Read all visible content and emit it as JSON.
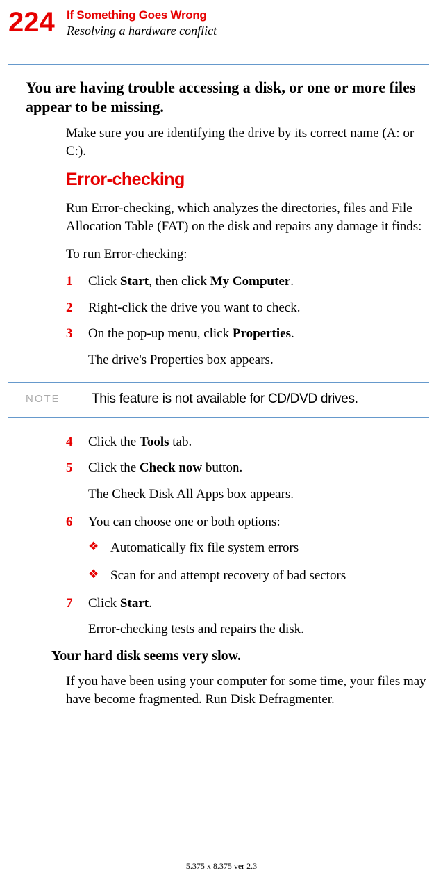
{
  "page_number": "224",
  "chapter_title": "If Something Goes Wrong",
  "section_subtitle": "Resolving a hardware conflict",
  "heading_trouble": "You are having trouble accessing a disk, or one or more files appear to be missing.",
  "trouble_body": "Make sure you are identifying the drive by its correct name (A: or C:).",
  "error_checking_heading": "Error-checking",
  "error_checking_intro": "Run Error-checking, which analyzes the directories, files and File Allocation Table (FAT) on the disk and repairs any damage it finds:",
  "to_run": "To run Error-checking:",
  "steps": {
    "s1_num": "1",
    "s1_prefix": "Click ",
    "s1_bold1": "Start",
    "s1_mid": ", then click ",
    "s1_bold2": "My Computer",
    "s1_suffix": ".",
    "s2_num": "2",
    "s2_text": "Right-click the drive you want to check.",
    "s3_num": "3",
    "s3_prefix": "On the pop-up menu, click ",
    "s3_bold": "Properties",
    "s3_suffix": ".",
    "s3_result": "The drive's Properties box appears.",
    "s4_num": "4",
    "s4_prefix": "Click the ",
    "s4_bold": "Tools",
    "s4_suffix": " tab.",
    "s5_num": "5",
    "s5_prefix": "Click the ",
    "s5_bold": "Check now",
    "s5_suffix": " button.",
    "s5_result": "The Check Disk All Apps box appears.",
    "s6_num": "6",
    "s6_text": "You can choose one or both options:",
    "s7_num": "7",
    "s7_prefix": "Click ",
    "s7_bold": "Start",
    "s7_suffix": ".",
    "s7_result": "Error-checking tests and repairs the disk."
  },
  "note_label": "NOTE",
  "note_text": "This feature is not available for CD/DVD drives.",
  "bullets": {
    "b1": "Automatically fix file system errors",
    "b2": "Scan for and attempt recovery of bad sectors"
  },
  "slow_heading": "Your hard disk seems very slow.",
  "slow_body": "If you have been using your computer for some time, your files may have become fragmented. Run Disk Defragmenter.",
  "footer": "5.375 x 8.375 ver 2.3"
}
